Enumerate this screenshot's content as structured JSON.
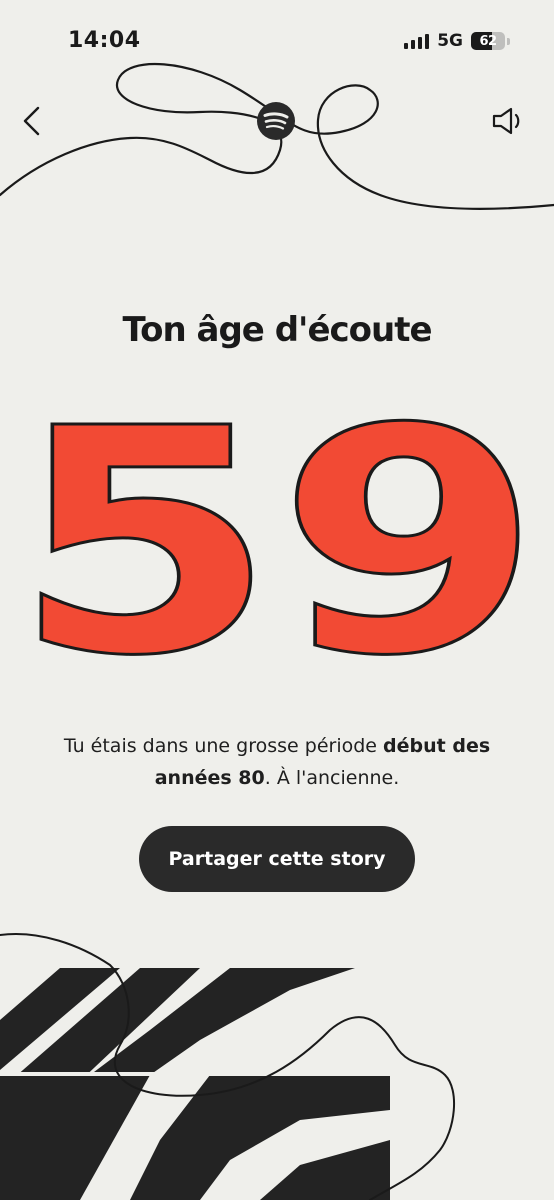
{
  "status_bar": {
    "time": "14:04",
    "network": "5G",
    "battery": "62",
    "battery_level": 0.62
  },
  "header": {
    "back_icon": "chevron-left-icon",
    "logo_icon": "spotify-logo-icon",
    "sound_icon": "speaker-icon"
  },
  "title": "Ton âge d'écoute",
  "age": "59",
  "caption": {
    "part1": "Tu étais dans une grosse période ",
    "bold": "début des années 80",
    "part2": ". À l'ancienne."
  },
  "share_button": "Partager cette story",
  "colors": {
    "background": "#efefeb",
    "accent": "#f24a34",
    "dark": "#2a2a2a"
  }
}
